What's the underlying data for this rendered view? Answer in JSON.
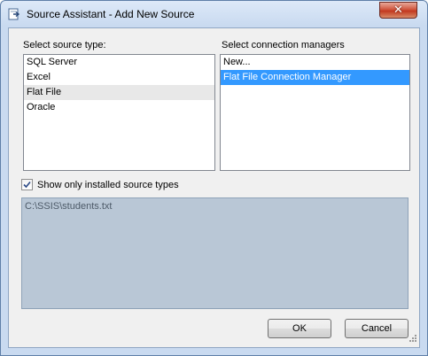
{
  "window": {
    "title": "Source Assistant - Add New Source",
    "close_glyph": "✕"
  },
  "source_type": {
    "label": "Select source type:",
    "items": [
      "SQL Server",
      "Excel",
      "Flat File",
      "Oracle"
    ],
    "highlighted": "Flat File"
  },
  "connection_managers": {
    "label": "Select connection managers",
    "items": [
      "New...",
      "Flat File Connection Manager"
    ],
    "selected": "Flat File Connection Manager"
  },
  "filter": {
    "label": "Show only installed source types",
    "checked": true
  },
  "details": {
    "text": "C:\\SSIS\\students.txt"
  },
  "buttons": {
    "ok": "OK",
    "cancel": "Cancel"
  },
  "icons": {
    "title": "add-source-icon",
    "close": "close-icon",
    "check": "checkmark-icon",
    "grip": "resize-grip-icon"
  },
  "colors": {
    "selection": "#3399ff",
    "hover": "#e8e8e8",
    "details_bg": "#b9c7d6",
    "close": "#c2381f"
  }
}
